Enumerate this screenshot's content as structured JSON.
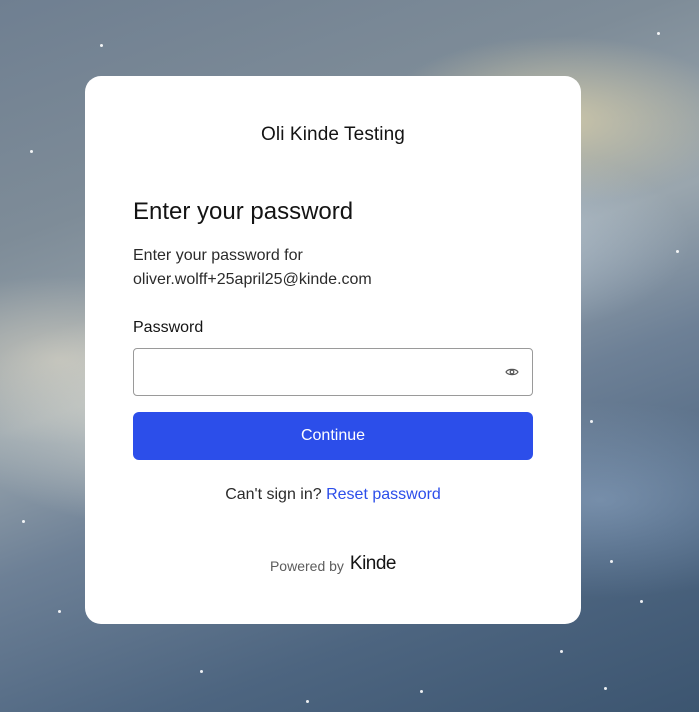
{
  "business_name": "Oli Kinde Testing",
  "heading": "Enter your password",
  "subtext_line1": "Enter your password for",
  "email": "oliver.wolff+25april25@kinde.com",
  "password_field": {
    "label": "Password",
    "value": "",
    "toggle_icon": "eye-icon"
  },
  "continue_label": "Continue",
  "help": {
    "prompt": "Can't sign in?",
    "link_label": "Reset password"
  },
  "footer": {
    "powered_by": "Powered by",
    "brand": "Kinde"
  },
  "colors": {
    "primary": "#2c4eea",
    "text": "#141414",
    "card": "#ffffff"
  }
}
